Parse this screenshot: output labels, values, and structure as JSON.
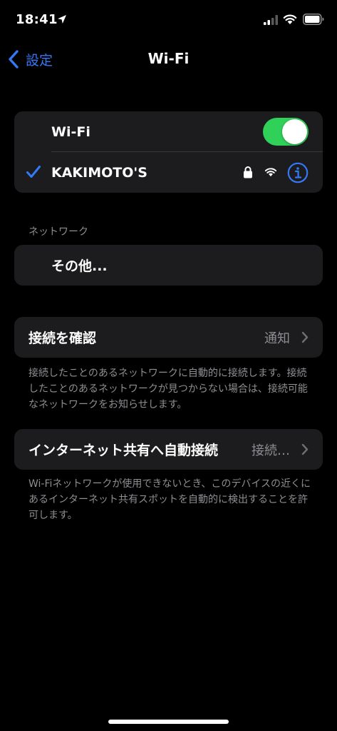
{
  "status_bar": {
    "time": "18:41"
  },
  "nav": {
    "back_label": "設定",
    "title": "Wi-Fi"
  },
  "wifi_group": {
    "toggle_label": "Wi-Fi",
    "toggle_on": true,
    "connected_network": "KAKIMOTO'S"
  },
  "networks_section": {
    "header": "ネットワーク",
    "other_label": "その他..."
  },
  "ask_to_join": {
    "label": "接続を確認",
    "value": "通知",
    "footer": "接続したことのあるネットワークに自動的に接続します。接続したことのあるネットワークが見つからない場合は、接続可能なネットワークをお知らせします。"
  },
  "auto_join_hotspot": {
    "label": "インターネット共有へ自動接続",
    "value": "接続…",
    "footer": "Wi-Fiネットワークが使用できないとき、このデバイスの近くにあるインターネット共有スポットを自動的に検出することを許可します。"
  },
  "colors": {
    "accent": "#3478f6",
    "toggle_on": "#30d158",
    "group_bg": "#1c1c1e",
    "secondary_text": "#8e8e93"
  },
  "icons": [
    "location-arrow-icon",
    "cellular-signal-icon",
    "wifi-icon",
    "battery-icon",
    "back-chevron-icon",
    "checkmark-icon",
    "lock-icon",
    "info-icon",
    "chevron-right-icon"
  ]
}
